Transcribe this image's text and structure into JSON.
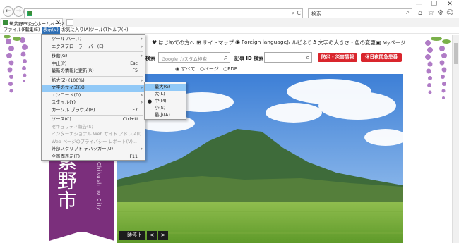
{
  "browser": {
    "address_text": "",
    "search_placeholder": "検索...",
    "tab_title": "筑紫野市公式ホームページ",
    "tab_close": "×",
    "back_glyph": "←",
    "forward_glyph": "→",
    "refresh_glyph": "C",
    "search_glyph": "⌕",
    "minimize_glyph": "—",
    "restore_glyph": "❐",
    "close_glyph": "✕",
    "home_glyph": "⌂",
    "star_glyph": "☆",
    "settings_glyph": "⚙",
    "smile_glyph": "☺"
  },
  "menubar": [
    "ファイル(F)",
    "編集(E)",
    "表示(V)",
    "お気に入り(A)",
    "ツール(T)",
    "ヘルプ(H)"
  ],
  "view_menu": {
    "items": [
      {
        "label": "ツール バー(T)",
        "shortcut": "",
        "arrow": "›",
        "disabled": false
      },
      {
        "label": "エクスプローラー バー(E)",
        "shortcut": "",
        "arrow": "›",
        "disabled": false
      },
      {
        "sep": true
      },
      {
        "label": "移動(G)",
        "shortcut": "",
        "arrow": "›",
        "disabled": false
      },
      {
        "label": "中止(P)",
        "shortcut": "Esc",
        "arrow": "",
        "disabled": false
      },
      {
        "label": "最新の情報に更新(R)",
        "shortcut": "F5",
        "arrow": "",
        "disabled": false
      },
      {
        "sep": true
      },
      {
        "label": "拡大(Z) (100%)",
        "shortcut": "",
        "arrow": "›",
        "disabled": false
      },
      {
        "label": "文字のサイズ(X)",
        "shortcut": "",
        "arrow": "›",
        "disabled": false,
        "highlight": true
      },
      {
        "label": "エンコード(D)",
        "shortcut": "",
        "arrow": "›",
        "disabled": false
      },
      {
        "label": "スタイル(Y)",
        "shortcut": "",
        "arrow": "›",
        "disabled": false
      },
      {
        "label": "カーソル ブラウズ(B)",
        "shortcut": "F7",
        "arrow": "",
        "disabled": false
      },
      {
        "sep": true
      },
      {
        "label": "ソース(C)",
        "shortcut": "Ctrl+U",
        "arrow": "",
        "disabled": false
      },
      {
        "label": "セキュリティ報告(S)",
        "shortcut": "",
        "arrow": "",
        "disabled": true
      },
      {
        "label": "インターナショナル Web サイト アドレス(I)",
        "shortcut": "",
        "arrow": "",
        "disabled": true
      },
      {
        "label": "Web ページのプライバシー レポート(V)...",
        "shortcut": "",
        "arrow": "",
        "disabled": true
      },
      {
        "label": "外部スクリプト デバッガー(U)",
        "shortcut": "",
        "arrow": "›",
        "disabled": false
      },
      {
        "label": "全画面表示(F)",
        "shortcut": "F11",
        "arrow": "",
        "disabled": false
      }
    ]
  },
  "text_size_menu": {
    "items": [
      {
        "label": "最大(G)",
        "checked": false,
        "hover": true
      },
      {
        "label": "大(L)",
        "checked": false
      },
      {
        "label": "中(M)",
        "checked": true
      },
      {
        "label": "小(S)",
        "checked": false
      },
      {
        "label": "最小(A)",
        "checked": false
      }
    ],
    "check_glyph": "●"
  },
  "site": {
    "links": [
      {
        "icon": "♥",
        "label": "はじめての方へ"
      },
      {
        "icon": "⊞",
        "label": "サイトマップ"
      },
      {
        "icon": "◉",
        "label": "Foreign language"
      },
      {
        "icon": "ふ",
        "label": "ルビふり"
      },
      {
        "icon": "A",
        "label": "文字の大きさ・色の変更"
      },
      {
        "icon": "▣",
        "label": "Myページ"
      }
    ],
    "search_label_tail": "検索",
    "google_placeholder": "Google カスタム検索",
    "search_icon": "⌕",
    "article_id_label": "記事 ID 検索",
    "disaster_button": "防災・災害情報",
    "holiday_button": "休日夜間急患番",
    "radio_options": [
      "すべて",
      "ページ",
      "PDF"
    ],
    "radio_selected": "すべて",
    "banner_kanji": "紫野市",
    "banner_city": "Chikushino City",
    "pause_button": "一時停止",
    "prev_button": "<",
    "next_button": ">"
  },
  "colors": {
    "menu_highlight": "#91c9f7",
    "menubar_active": "#2f6fb5",
    "banner_purple": "#7b2f7c",
    "red_button": "#d9252c",
    "wisteria": "#b07cc6"
  }
}
